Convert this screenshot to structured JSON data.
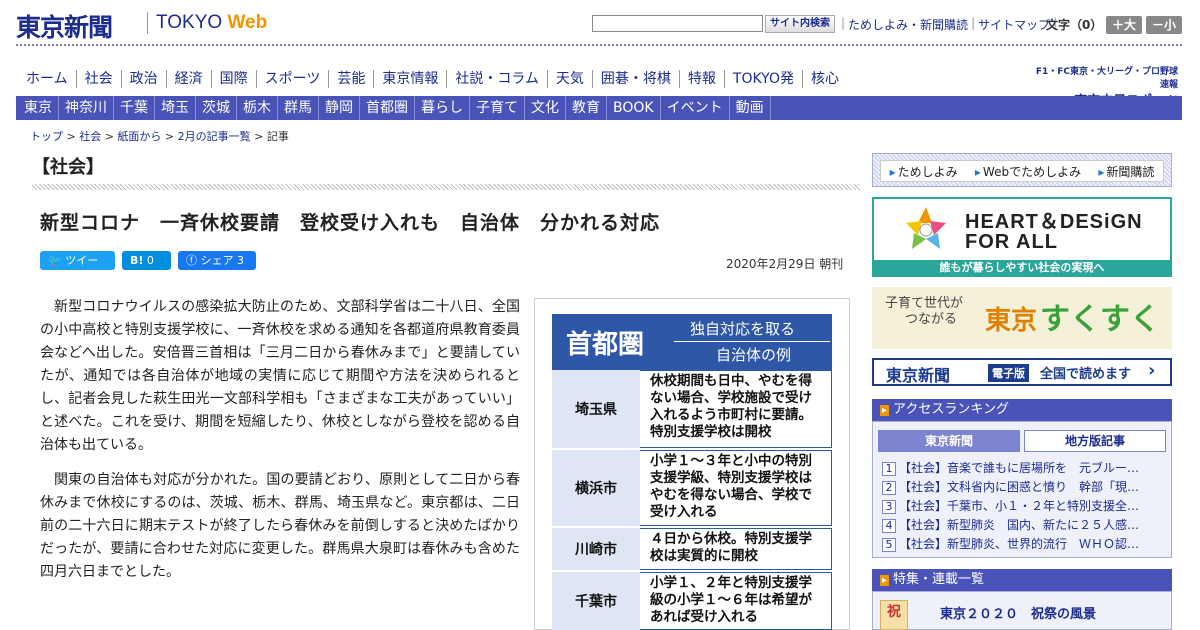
{
  "header": {
    "logo_jp": "東京新聞",
    "logo_tokyo": "TOKYO",
    "logo_web": "Web",
    "search_button": "サイト内検索",
    "top_links": [
      "ためしよみ・新聞購読",
      "サイトマップ"
    ],
    "font_size_label": "文字（0）",
    "font_up": "＋大",
    "font_down": "－小"
  },
  "nav_main": [
    "ホーム",
    "社会",
    "政治",
    "経済",
    "国際",
    "スポーツ",
    "芸能",
    "東京情報",
    "社説・コラム",
    "天気",
    "囲碁・将棋",
    "特報",
    "TOKYO発",
    "核心"
  ],
  "chunichi": {
    "line1": "F1・FC東京・大リーグ・プロ野球速報",
    "line2": "▸東京中日スポーツ"
  },
  "nav_region": [
    "東京",
    "神奈川",
    "千葉",
    "埼玉",
    "茨城",
    "栃木",
    "群馬",
    "静岡",
    "首都圏",
    "暮らし",
    "子育て",
    "文化",
    "教育",
    "BOOK",
    "イベント",
    "動画"
  ],
  "breadcrumb": {
    "items": [
      "トップ",
      "社会",
      "紙面から",
      "2月の記事一覧"
    ],
    "current": "記事",
    "sep": " > "
  },
  "article": {
    "section": "【社会】",
    "headline": "新型コロナ　一斉休校要請　登校受け入れも　自治体　分かれる対応",
    "share": {
      "tweet": "ツイート",
      "hatena": "B!",
      "hatena_count": "0",
      "facebook": "シェア",
      "facebook_count": "3"
    },
    "date": "2020年2月29日 朝刊",
    "paragraphs": [
      "新型コロナウイルスの感染拡大防止のため、文部科学省は二十八日、全国の小中高校と特別支援学校に、一斉休校を求める通知を各都道府県教育委員会などへ出した。安倍晋三首相は「三月二日から春休みまで」と要請していたが、通知では各自治体が地域の実情に応じて期間や方法を決められるとし、記者会見した萩生田光一文部科学相も「さまざまな工夫があっていい」と述べた。これを受け、期間を短縮したり、休校としながら登校を認める自治体も出ている。",
      "関東の自治体も対応が分かれた。国の要請どおり、原則として二日から春休みまで休校にするのは、茨城、栃木、群馬、埼玉県など。東京都は、二日前の二十六日に期末テストが終了したら春休みを前倒しすると決めたばかりだったが、要請に合わせた対応に変更した。群馬県大泉町は春休みも含めた四月六日までとした。"
    ],
    "figure": {
      "title_big": "首都圏",
      "title_line1": "独自対応を取る",
      "title_line2": "自治体の例",
      "rows": [
        {
          "pref": "埼玉県",
          "desc": "休校期間も日中、やむを得ない場合、学校施設で受け入れるよう市町村に要請。特別支援学校は開校"
        },
        {
          "pref": "横浜市",
          "desc": "小学１～３年と小中の特別支援学級、特別支援学校はやむを得ない場合、学校で受け入れる"
        },
        {
          "pref": "川崎市",
          "desc": "４日から休校。特別支援学校は実質的に開校"
        },
        {
          "pref": "千葉市",
          "desc": "小学１、２年と特別支援学級の小学１～６年は希望があれば受け入れる"
        }
      ]
    }
  },
  "sidebar": {
    "quick_links": [
      "ためしよみ",
      "Webでためしよみ",
      "新聞購読"
    ],
    "hd_line1": "HEART＆DESiGN",
    "hd_line2": "FOR ALL",
    "hd_caption": "誰もが暮らしやすい社会の実現へ",
    "sk_line1": "子育て世代が",
    "sk_line2": "つながる",
    "sk_tokyo": "東京",
    "sk_sukusuku": "すくすく",
    "digital_logo": "東京新聞",
    "digital_badge": "電子版",
    "digital_text": "全国で読めます",
    "ranking_title": "アクセスランキング",
    "ranking_tab1": "東京新聞",
    "ranking_tab2": "地方版記事",
    "ranking": [
      {
        "n": "1",
        "text": "【社会】音楽で誰もに居場所を　元ブルー…"
      },
      {
        "n": "2",
        "text": "【社会】文科省内に困惑と憤り　幹部「現…"
      },
      {
        "n": "3",
        "text": "【社会】千葉市、小１・２年と特別支援全…"
      },
      {
        "n": "4",
        "text": "【社会】新型肺炎　国内、新たに２５人感…"
      },
      {
        "n": "5",
        "text": "【社会】新型肺炎、世界的流行　ＷＨＯ認…"
      }
    ],
    "feature_title": "特集・連載一覧",
    "feature_item": "東京２０２０　祝祭の風景",
    "feature_img_text": "祝"
  },
  "colors": {
    "brand_navy": "#1d2c8f",
    "nav_blue": "#4a54b8",
    "accent_orange": "#f29600",
    "teal": "#2aa69a",
    "figure_blue": "#2f57a8"
  }
}
